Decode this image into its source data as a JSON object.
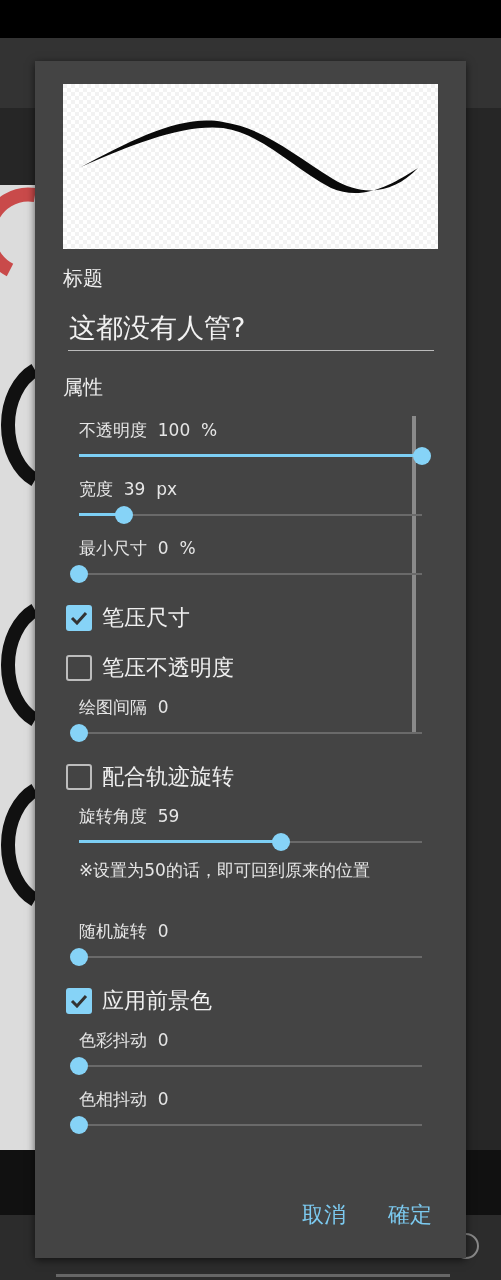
{
  "dialog": {
    "title_label": "标题",
    "title_value": "这都没有人管?",
    "section_label": "属性",
    "items": [
      {
        "kind": "slider",
        "label": "不透明度",
        "value": "100",
        "unit": "%",
        "level": 1.0
      },
      {
        "kind": "slider",
        "label": "宽度",
        "value": "39",
        "unit": "px",
        "level": 0.13
      },
      {
        "kind": "slider",
        "label": "最小尺寸",
        "value": "0",
        "unit": "%",
        "level": 0
      },
      {
        "kind": "checkbox",
        "label": "笔压尺寸",
        "checked": true
      },
      {
        "kind": "checkbox",
        "label": "笔压不透明度",
        "checked": false
      },
      {
        "kind": "slider",
        "label": "绘图间隔",
        "value": "0",
        "level": 0
      },
      {
        "kind": "checkbox",
        "label": "配合轨迹旋转",
        "checked": false
      },
      {
        "kind": "slider",
        "label": "旋转角度",
        "value": "59",
        "level": 0.59
      },
      {
        "kind": "note",
        "text": "※设置为50的话，即可回到原来的位置"
      },
      {
        "kind": "slider",
        "label": "随机旋转",
        "value": "0",
        "level": 0
      },
      {
        "kind": "checkbox",
        "label": "应用前景色",
        "checked": true
      },
      {
        "kind": "slider",
        "label": "色彩抖动",
        "value": "0",
        "level": 0
      },
      {
        "kind": "slider",
        "label": "色相抖动",
        "value": "0",
        "level": 0
      }
    ],
    "buttons": [
      "取消",
      "確定"
    ]
  }
}
